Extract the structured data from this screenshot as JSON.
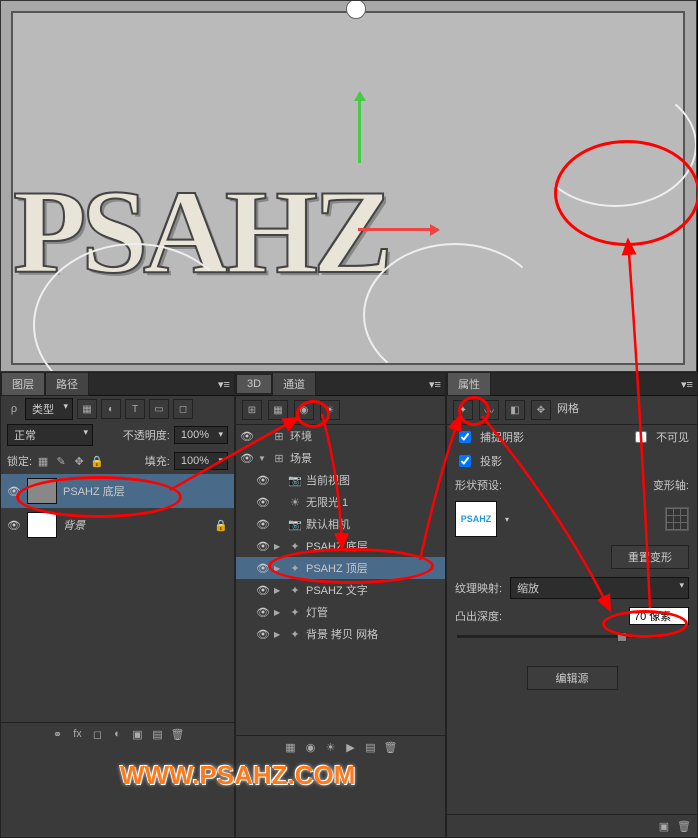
{
  "viewport": {
    "text3d": "PSAHZ"
  },
  "layers_panel": {
    "tab_layers": "图层",
    "tab_paths": "路径",
    "filter_label": "类型",
    "blend": "正常",
    "opacity_label": "不透明度:",
    "opacity_val": "100%",
    "lock_label": "锁定:",
    "fill_label": "填充:",
    "fill_val": "100%",
    "layer1": "PSAHZ 底层",
    "layer2": "背景"
  },
  "d3_panel": {
    "tab_3d": "3D",
    "tab_channels": "通道",
    "items": {
      "env": "环境",
      "scene": "场景",
      "view": "当前视图",
      "light": "无限光 1",
      "cam": "默认相机",
      "bottom": "PSAHZ 底层",
      "top": "PSAHZ 顶层",
      "text": "PSAHZ 文字",
      "lamp": "灯管",
      "bgmesh": "背景 拷贝 网格"
    }
  },
  "props_panel": {
    "tab": "属性",
    "mesh": "网格",
    "shadow": "捕捉阴影",
    "invisible": "不可见",
    "cast": "投影",
    "shape_preset": "形状预设:",
    "deform": "变形轴:",
    "preset_text": "PSAHZ",
    "reset_deform": "重置变形",
    "tex_map": "纹理映射:",
    "tex_val": "缩放",
    "extrude": "凸出深度:",
    "extrude_val": "70 像素",
    "edit_source": "编辑源"
  },
  "watermark": "WWW.PSAHZ.COM"
}
